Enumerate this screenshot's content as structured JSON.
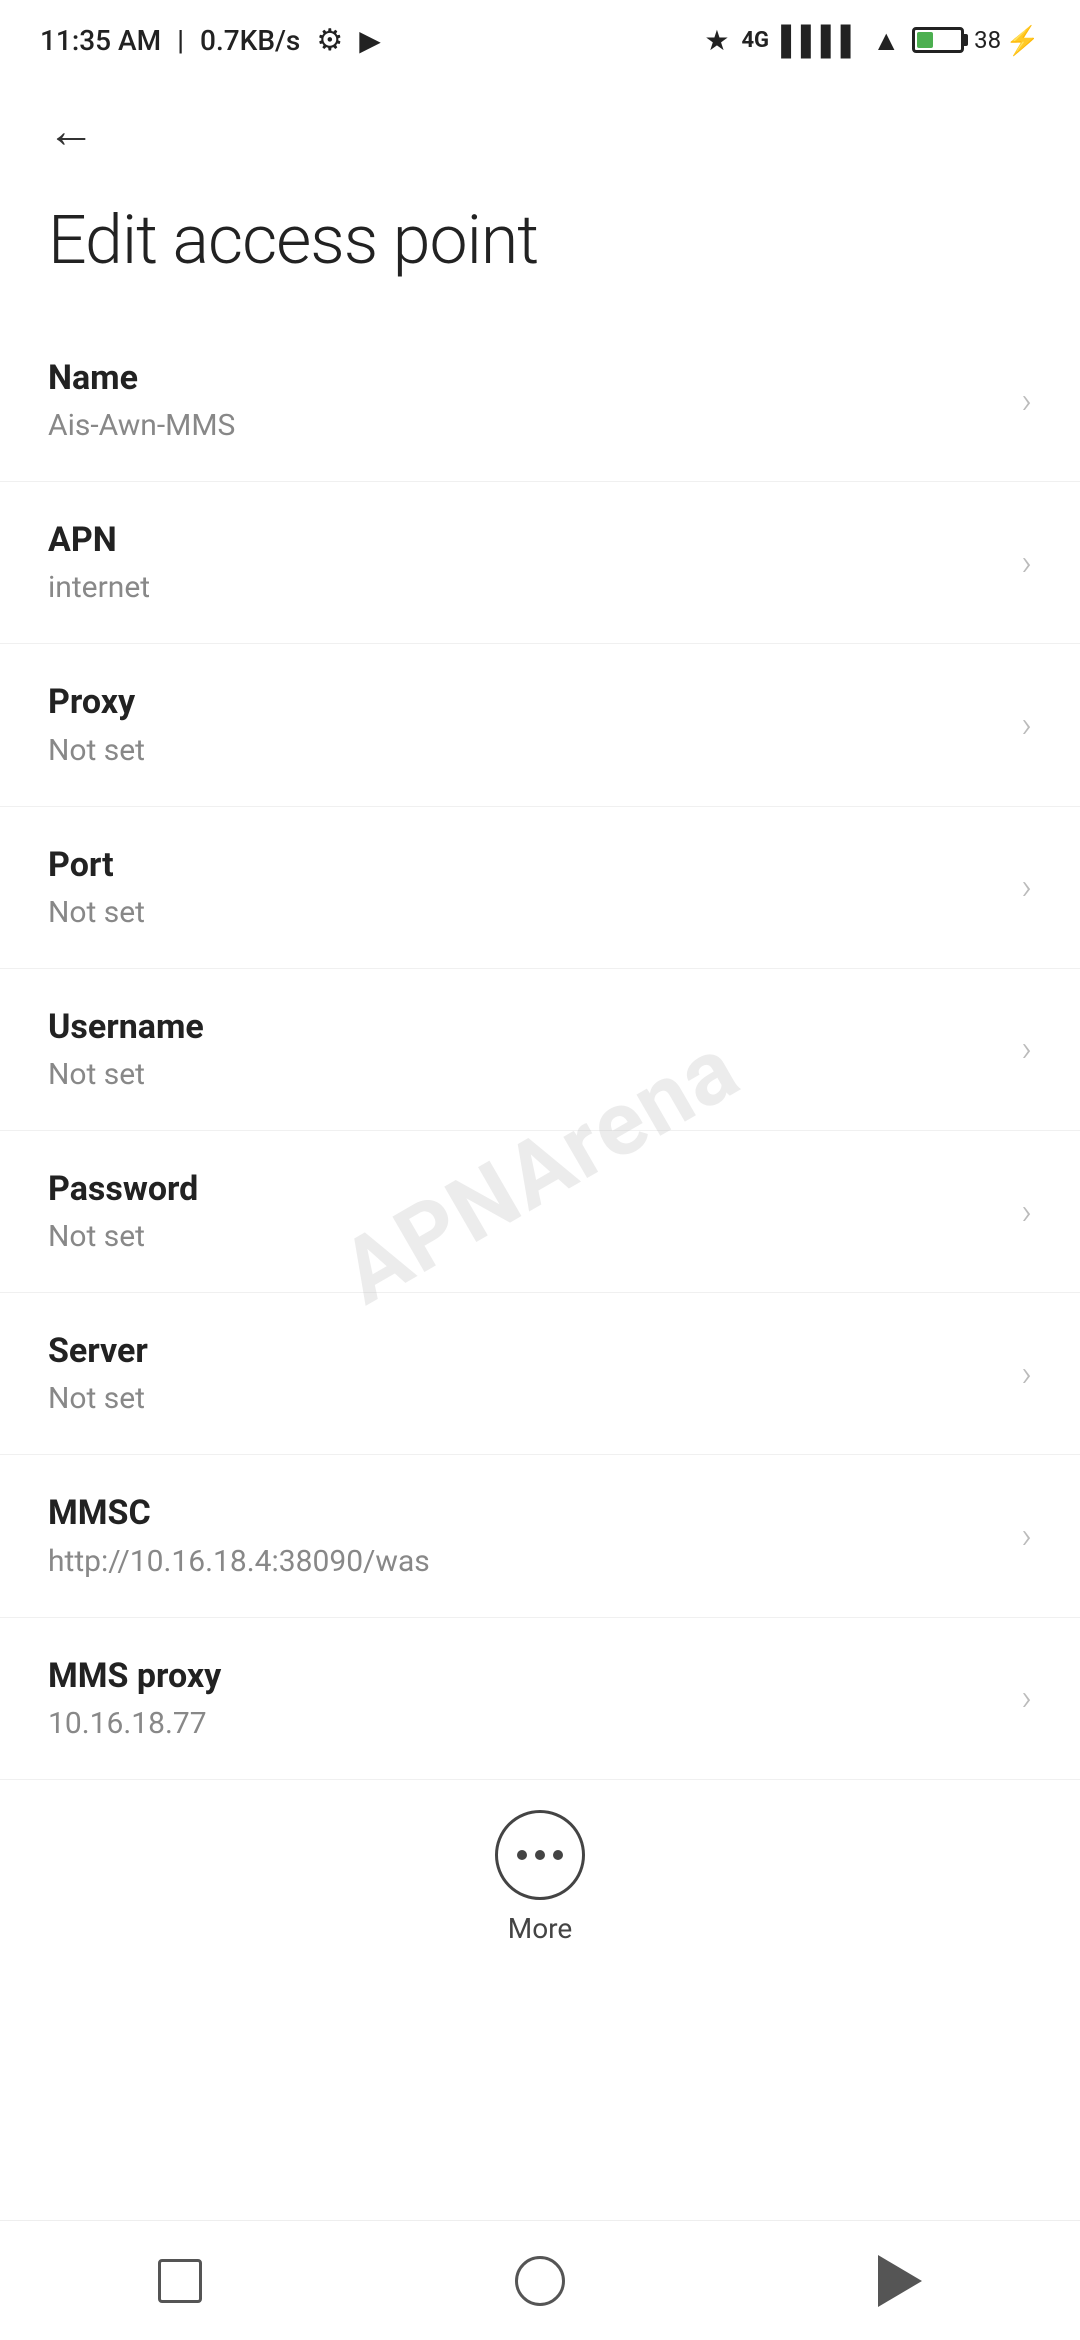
{
  "status_bar": {
    "time": "11:35 AM",
    "speed": "0.7KB/s",
    "battery_percent": "38"
  },
  "page": {
    "title": "Edit access point",
    "back_label": "Back"
  },
  "settings": [
    {
      "id": "name",
      "label": "Name",
      "value": "Ais-Awn-MMS"
    },
    {
      "id": "apn",
      "label": "APN",
      "value": "internet"
    },
    {
      "id": "proxy",
      "label": "Proxy",
      "value": "Not set"
    },
    {
      "id": "port",
      "label": "Port",
      "value": "Not set"
    },
    {
      "id": "username",
      "label": "Username",
      "value": "Not set"
    },
    {
      "id": "password",
      "label": "Password",
      "value": "Not set"
    },
    {
      "id": "server",
      "label": "Server",
      "value": "Not set"
    },
    {
      "id": "mmsc",
      "label": "MMSC",
      "value": "http://10.16.18.4:38090/was"
    },
    {
      "id": "mms-proxy",
      "label": "MMS proxy",
      "value": "10.16.18.77"
    }
  ],
  "more_button": {
    "label": "More"
  },
  "watermark": {
    "text": "APNArena"
  }
}
